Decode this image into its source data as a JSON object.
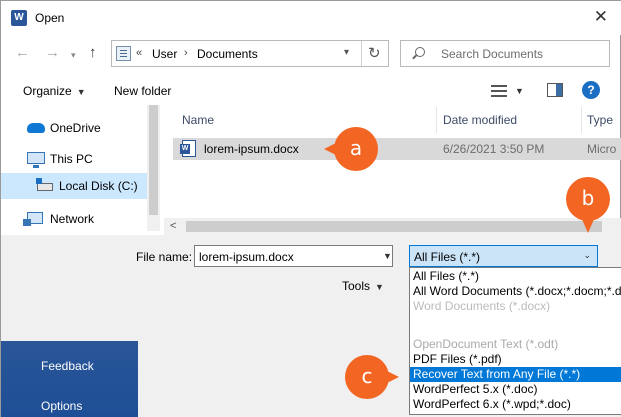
{
  "window": {
    "title": "Open",
    "close_glyph": "✕",
    "app_icon": "word-icon",
    "app_icon_letter": "W"
  },
  "navigation": {
    "back_glyph": "←",
    "forward_glyph": "→",
    "up_glyph": "↑",
    "refresh_glyph": "↻"
  },
  "address": {
    "overflow": "«",
    "crumbs": [
      "User",
      "Documents"
    ],
    "separator": "›"
  },
  "search": {
    "placeholder": "Search Documents"
  },
  "toolbar": {
    "organize_label": "Organize",
    "new_folder_label": "New folder",
    "help_glyph": "?"
  },
  "nav_pane": {
    "items": [
      {
        "label": "OneDrive",
        "icon": "cloud-icon"
      },
      {
        "label": "This PC",
        "icon": "computer-icon"
      },
      {
        "label": "Local Disk (C:)",
        "icon": "disk-icon",
        "selected": true
      },
      {
        "label": "Network",
        "icon": "network-icon"
      }
    ]
  },
  "file_list": {
    "columns": [
      "Name",
      "Date modified",
      "Type"
    ],
    "rows": [
      {
        "name": "lorem-ipsum.docx",
        "date": "6/26/2021 3:50 PM",
        "type": "Micro",
        "icon": "word-document-icon"
      }
    ]
  },
  "bottom": {
    "file_name_label": "File name:",
    "file_name_value": "lorem-ipsum.docx",
    "file_type_selected": "All Files (*.*)",
    "tools_label": "Tools",
    "file_type_options": [
      "All Files (*.*)",
      "All Word Documents (*.docx;*.docm;*.d",
      "Word Documents (*.docx)",
      "OpenDocument Text (*.odt)",
      "PDF Files (*.pdf)",
      "Recover Text from Any File (*.*)",
      "WordPerfect 5.x (*.doc)",
      "WordPerfect 6.x (*.wpd;*.doc)"
    ],
    "highlighted_option_index": 5
  },
  "sidebar": {
    "feedback_label": "Feedback",
    "options_label": "Options"
  },
  "annotations": {
    "a": "a",
    "b": "b",
    "c": "c",
    "color": "#f26522"
  },
  "colors": {
    "accent": "#0078d7",
    "selected_bg": "#cce8ff",
    "word_blue": "#2b579a"
  }
}
